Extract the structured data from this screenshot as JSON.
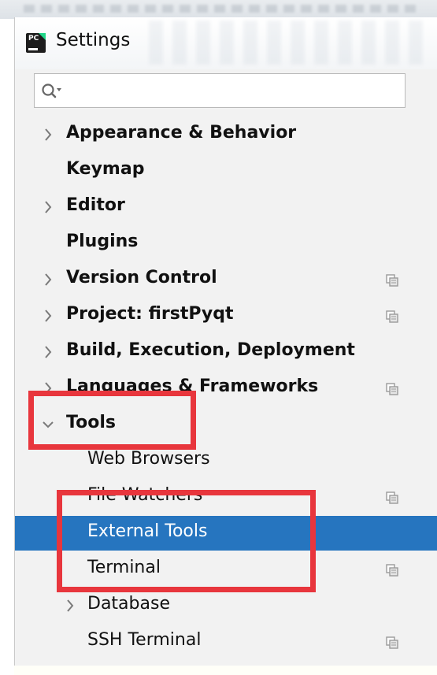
{
  "window": {
    "title": "Settings",
    "app_icon_text": "PC"
  },
  "search": {
    "value": "",
    "placeholder": ""
  },
  "tree": [
    {
      "label": "Appearance & Behavior",
      "bold": true,
      "level": 0,
      "expander": "collapsed",
      "copy_icon": false
    },
    {
      "label": "Keymap",
      "bold": true,
      "level": 0,
      "expander": "none",
      "copy_icon": false
    },
    {
      "label": "Editor",
      "bold": true,
      "level": 0,
      "expander": "collapsed",
      "copy_icon": false
    },
    {
      "label": "Plugins",
      "bold": true,
      "level": 0,
      "expander": "none",
      "copy_icon": false
    },
    {
      "label": "Version Control",
      "bold": true,
      "level": 0,
      "expander": "collapsed",
      "copy_icon": true
    },
    {
      "label": "Project: firstPyqt",
      "bold": true,
      "level": 0,
      "expander": "collapsed",
      "copy_icon": true
    },
    {
      "label": "Build, Execution, Deployment",
      "bold": true,
      "level": 0,
      "expander": "collapsed",
      "copy_icon": false
    },
    {
      "label": "Languages & Frameworks",
      "bold": true,
      "level": 0,
      "expander": "collapsed",
      "copy_icon": true
    },
    {
      "label": "Tools",
      "bold": true,
      "level": 0,
      "expander": "expanded",
      "copy_icon": false
    },
    {
      "label": "Web Browsers",
      "bold": false,
      "level": 1,
      "expander": "none",
      "copy_icon": false
    },
    {
      "label": "File Watchers",
      "bold": false,
      "level": 1,
      "expander": "none",
      "copy_icon": true
    },
    {
      "label": "External Tools",
      "bold": false,
      "level": 1,
      "expander": "none",
      "copy_icon": false,
      "selected": true
    },
    {
      "label": "Terminal",
      "bold": false,
      "level": 1,
      "expander": "none",
      "copy_icon": true
    },
    {
      "label": "Database",
      "bold": false,
      "level": 1,
      "expander": "collapsed",
      "copy_icon": false
    },
    {
      "label": "SSH Terminal",
      "bold": false,
      "level": 1,
      "expander": "none",
      "copy_icon": true
    }
  ],
  "colors": {
    "selection": "#2675bf",
    "annotation_box": "#e8363d",
    "panel_background": "#f2f2f2"
  },
  "icons": {
    "app": "pycharm-app-icon",
    "search": "search-icon",
    "expander_collapsed": "chevron-right-icon",
    "expander_expanded": "chevron-down-icon",
    "project_scope": "copy-icon"
  }
}
